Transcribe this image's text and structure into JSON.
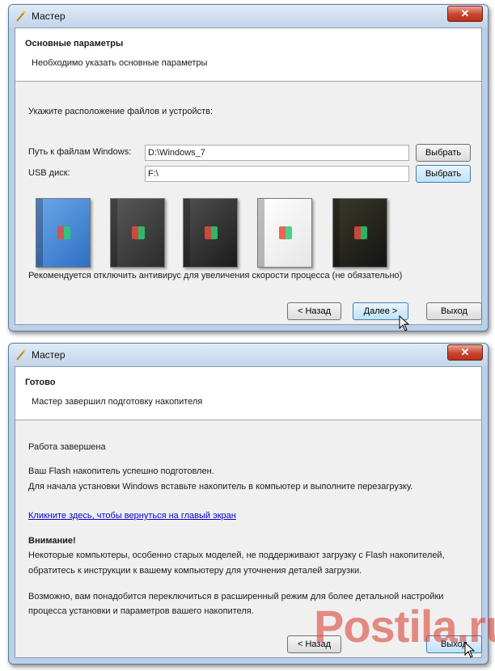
{
  "window1": {
    "title": "Мастер",
    "close_label": "✕",
    "header_title": "Основные параметры",
    "header_sub": "Необходимо указать основные параметры",
    "section_label": "Укажите расположение файлов и устройств:",
    "windows_path_label": "Путь к файлам Windows:",
    "windows_path_value": "D:\\Windows_7",
    "usb_label": "USB диск:",
    "usb_value": "F:\\",
    "browse1_label": "Выбрать",
    "browse2_label": "Выбрать",
    "boxes": [
      {
        "name": "windows-xp-box",
        "colors": [
          "#2f6fc4",
          "#6aa7e8"
        ]
      },
      {
        "name": "windows-xp-media-center-box",
        "colors": [
          "#2b2b2b",
          "#595959"
        ]
      },
      {
        "name": "windows-vista-box",
        "colors": [
          "#1c1c1c",
          "#4f4f4f"
        ]
      },
      {
        "name": "windows-vista-white-box",
        "colors": [
          "#e6e6e6",
          "#ffffff"
        ]
      },
      {
        "name": "windows-7-box",
        "colors": [
          "#141414",
          "#3a3a2a"
        ]
      }
    ],
    "notice": "Рекомендуется отключить антивирус для увеличения скорости процесса (не обязательно)",
    "back_label": "< Назад",
    "next_label": "Далее >",
    "exit_label": "Выход"
  },
  "window2": {
    "title": "Мастер",
    "close_label": "✕",
    "header_title": "Готово",
    "header_sub": "Мастер завершил подготовку накопителя",
    "done_text": "Работа завершена",
    "success_line1": "Ваш Flash накопитель успешно подготовлен.",
    "success_line2": "Для начала установки Windows вставьте накопитель в компьютер и выполните перезагрузку.",
    "home_link": "Кликните здесь, чтобы вернуться на главый экран",
    "warning_title": "Внимание!",
    "warning_line1": "Некоторые компьютеры, особенно старых моделей, не поддерживают загрузку с Flash накопителей,",
    "warning_line2": "обратитесь к инструкции к вашему компьютеру для уточнения деталей загрузки.",
    "hint_line1": "Возможно, вам понадобится переключиться в расширенный режим для более детальной настройки",
    "hint_line2": "процесса установки и параметров вашего накопителя.",
    "back_label": "< Назад",
    "exit_label": "Выход"
  },
  "watermark": "Postila.ru"
}
